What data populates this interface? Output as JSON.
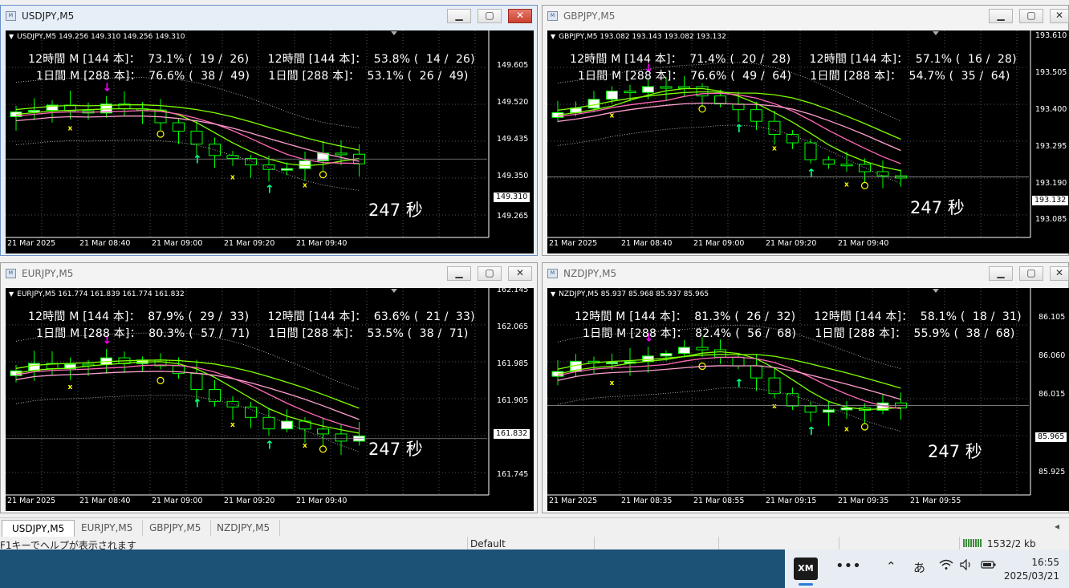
{
  "stat_template": {
    "h12": "12時間 M [144 本]",
    "h12b": "12時間 [144 本]",
    "d1": "1日間 M [288 本]",
    "d1b": "1日間 [288 本]"
  },
  "windows": [
    {
      "title": "USDJPY,M5",
      "symbol": "USDJPY,M5",
      "ohlc": "149.256 149.310 149.256 149.310",
      "stats": [
        "12時間 M [144 本]：  73.1% (  19 /  26)     12時間 [144 本]：  53.8% (  14 /  26)",
        "1日間 M [288 本]：  76.6% (  38 /  49)     1日間 [288 本]：  53.1% (  26 /  49)"
      ],
      "countdown": "247 秒",
      "current_price": "149.310",
      "y_ticks": [
        "149.605",
        "149.520",
        "149.435",
        "149.350",
        "149.265"
      ],
      "x_ticks": [
        "21 Mar 2025",
        "21 Mar 08:40",
        "21 Mar 09:00",
        "21 Mar 09:20",
        "21 Mar 09:40"
      ]
    },
    {
      "title": "GBPJPY,M5",
      "symbol": "GBPJPY,M5",
      "ohlc": "193.082 193.143 193.082 193.132",
      "stats": [
        "12時間 M [144 本]：  71.4% (  20 /  28)     12時間 [144 本]：  57.1% (  16 /  28)",
        "1日間 M [288 本]：  76.6% (  49 /  64)     1日間 [288 本]：  54.7% (  35 /  64)"
      ],
      "countdown": "247 秒",
      "current_price": "193.132",
      "y_ticks": [
        "193.610",
        "193.505",
        "193.400",
        "193.295",
        "193.190",
        "193.085"
      ],
      "x_ticks": [
        "21 Mar 2025",
        "21 Mar 08:40",
        "21 Mar 09:00",
        "21 Mar 09:20",
        "21 Mar 09:40"
      ]
    },
    {
      "title": "EURJPY,M5",
      "symbol": "EURJPY,M5",
      "ohlc": "161.774 161.839 161.774 161.832",
      "stats": [
        "12時間 M [144 本]：  87.9% (  29 /  33)     12時間 [144 本]：  63.6% (  21 /  33)",
        "1日間 M [288 本]：  80.3% (  57 /  71)     1日間 [288 本]：  53.5% (  38 /  71)"
      ],
      "countdown": "247 秒",
      "current_price": "161.832",
      "y_ticks": [
        "162.145",
        "162.065",
        "161.985",
        "161.905",
        "161.745"
      ],
      "x_ticks": [
        "21 Mar 2025",
        "21 Mar 08:40",
        "21 Mar 09:00",
        "21 Mar 09:20",
        "21 Mar 09:40"
      ]
    },
    {
      "title": "NZDJPY,M5",
      "symbol": "NZDJPY,M5",
      "ohlc": "85.937 85.968 85.937 85.965",
      "stats": [
        "12時間 M [144 本]：  81.3% (  26 /  32)     12時間 [144 本]：  58.1% (  18 /  31)",
        "1日間 M [288 本]：  82.4% (  56 /  68)     1日間 [288 本]：  55.9% (  38 /  68)"
      ],
      "countdown": "247 秒",
      "current_price": "85.965",
      "y_ticks": [
        "86.105",
        "86.060",
        "86.015",
        "85.925"
      ],
      "x_ticks": [
        "21 Mar 2025",
        "21 Mar 08:35",
        "21 Mar 08:55",
        "21 Mar 09:15",
        "21 Mar 09:35",
        "21 Mar 09:55"
      ]
    }
  ],
  "tabs": [
    "USDJPY,M5",
    "EURJPY,M5",
    "GBPJPY,M5",
    "NZDJPY,M5"
  ],
  "status": {
    "help": "F1キーでヘルプが表示されます",
    "profile": "Default",
    "traffic": "1532/2 kb"
  },
  "taskbar": {
    "app": "XM",
    "ime": "あ",
    "time": "16:55",
    "date": "2025/03/21"
  },
  "colors": {
    "bull": "#ffffff",
    "bear": "#000000",
    "wick": "#00ff00",
    "ma_fast": "#ff69b4",
    "ma_slow": "#7fff00",
    "marker_buy": "#00ff7f",
    "marker_sell": "#ff00ff",
    "marker_x": "#ffff00"
  }
}
